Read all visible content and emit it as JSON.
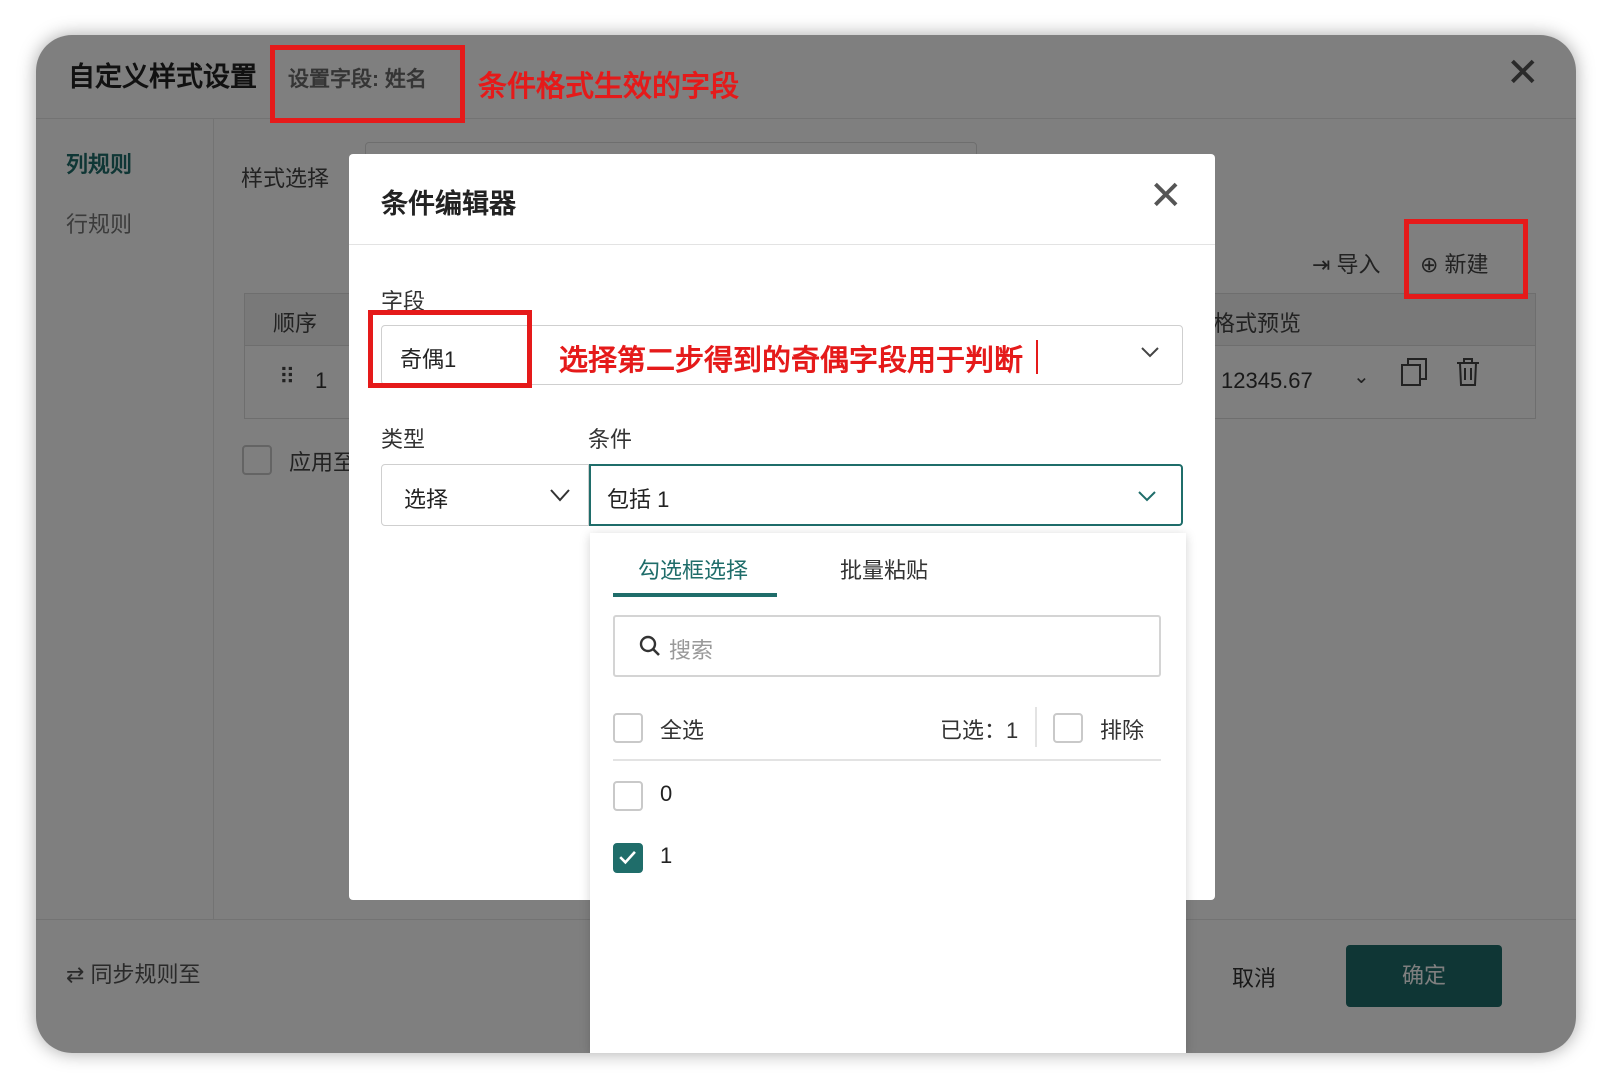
{
  "background_dialog": {
    "title": "自定义样式设置",
    "field_setting": "设置字段: 姓名",
    "close_icon": "✕",
    "sidebar": {
      "items": [
        {
          "label": "列规则",
          "active": true
        },
        {
          "label": "行规则",
          "active": false
        }
      ]
    },
    "style_select_label": "样式选择",
    "actions": {
      "import_label": "导入",
      "new_label": "新建"
    },
    "table": {
      "headers": {
        "order": "顺序",
        "preview": "格式预览"
      },
      "row": {
        "drag_handle": "⠿",
        "order": "1",
        "preview": "12345.67"
      }
    },
    "apply_label": "应用至",
    "footer": {
      "sync_label": "同步规则至",
      "cancel_label": "取消",
      "confirm_label": "确定"
    }
  },
  "modal": {
    "title": "条件编辑器",
    "close_icon": "✕",
    "field_label": "字段",
    "field_value": "奇偶1",
    "type_label": "类型",
    "type_value": "选择",
    "condition_label": "条件",
    "condition_value": "包括 1"
  },
  "dropdown": {
    "tabs": [
      {
        "label": "勾选框选择",
        "active": true
      },
      {
        "label": "批量粘贴",
        "active": false
      }
    ],
    "search_placeholder": "搜索",
    "select_all_label": "全选",
    "selected_text": "已选：1",
    "exclude_label": "排除",
    "options": [
      {
        "label": "0",
        "checked": false
      },
      {
        "label": "1",
        "checked": true
      }
    ]
  },
  "annotations": {
    "field_note": "条件格式生效的字段",
    "odd_even_note": "选择第二步得到的奇偶字段用于判断"
  },
  "colors": {
    "accent": "#1f6d6a",
    "annotation_red": "#e51a1a"
  }
}
